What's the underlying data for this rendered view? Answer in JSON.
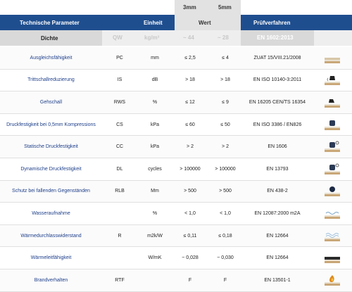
{
  "header": {
    "col_3mm": "3mm",
    "col_5mm": "5mm",
    "param": "Technische Parameter",
    "unit": "Einheit",
    "wert": "Wert",
    "method": "Prüfverfahren"
  },
  "subheader": {
    "name": "Dichte",
    "code": "QW",
    "unit": "kg/m³",
    "v3": "~ 44",
    "v5": "~ 28",
    "method": "EN 1602:2013"
  },
  "rows": [
    {
      "name": "Ausgleichsfähigkeit",
      "code": "PC",
      "unit": "mm",
      "v3": "≤ 2,5",
      "v5": "≤ 4",
      "method": "ZUAT 15/VIII.21/2008",
      "icon": "leveling-icon"
    },
    {
      "name": "Trittschallreduzierung",
      "code": "IS",
      "unit": "dB",
      "v3": "> 18",
      "v5": "> 18",
      "method": "EN ISO 10140-3:2011",
      "icon": "impact-sound-icon"
    },
    {
      "name": "Gehschall",
      "code": "RWS",
      "unit": "%",
      "v3": "≤ 12",
      "v5": "≤ 9",
      "method": "EN 16205 CEN/TS 16354",
      "icon": "walking-sound-icon"
    },
    {
      "name": "Druckfestigkeit bei 0,5mm Kompressions",
      "code": "CS",
      "unit": "kPa",
      "v3": "≤ 60",
      "v5": "≤ 50",
      "method": "EN ISO 3386 / EN826",
      "icon": "compression-weight-icon"
    },
    {
      "name": "Statische Druckfestigkeit",
      "code": "CC",
      "unit": "kPa",
      "v3": "> 2",
      "v5": "> 2",
      "method": "EN 1606",
      "icon": "static-load-icon"
    },
    {
      "name": "Dynamische Druckfestigkeit",
      "code": "DL",
      "unit": "cycles",
      "v3": "> 100000",
      "v5": "> 100000",
      "method": "EN 13793",
      "icon": "dynamic-load-icon"
    },
    {
      "name": "Schutz bei fallenden Gegenständen",
      "code": "RLB",
      "unit": "Mm",
      "v3": "> 500",
      "v5": "> 500",
      "method": "EN 438-2",
      "icon": "falling-ball-icon"
    },
    {
      "name": "Wasseraufnahme",
      "code": "",
      "unit": "%",
      "v3": "< 1,0",
      "v5": "< 1,0",
      "method": "EN 12087:2000 m2A",
      "icon": "water-absorption-icon"
    },
    {
      "name": "Wärmedurchlasswiderstand",
      "code": "R",
      "unit": "m2k/W",
      "v3": "≤ 0,11",
      "v5": "≤ 0,18",
      "method": "EN 12664",
      "icon": "heat-resistance-icon"
    },
    {
      "name": "Wärmeleitfähigkeit",
      "code": "",
      "unit": "W/mK",
      "v3": "~ 0,028",
      "v5": "~ 0,030",
      "method": "EN 12664",
      "icon": "heat-conductivity-icon"
    },
    {
      "name": "Brandverhalten",
      "code": "RTF",
      "unit": "",
      "v3": "F",
      "v5": "F",
      "method": "EN 13501-1",
      "icon": "fire-icon"
    }
  ],
  "colors": {
    "header_blue": "#1f4e8f",
    "label_blue": "#1e3f8a",
    "stripe": "#f2f2f2",
    "top_gray": "#e2e2e2"
  }
}
